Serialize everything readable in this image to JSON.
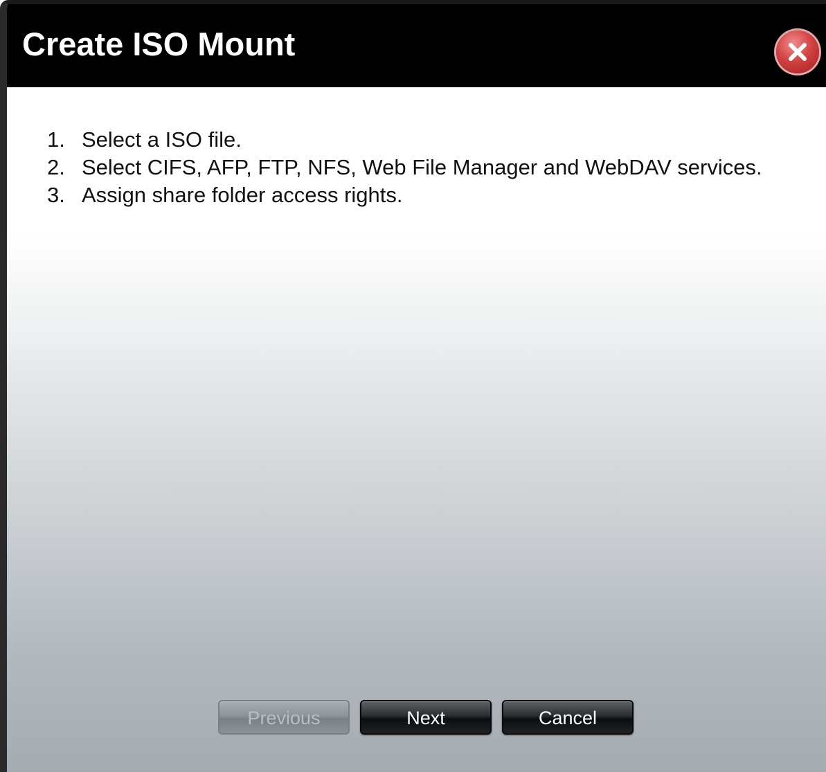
{
  "dialog": {
    "title": "Create ISO Mount",
    "steps": [
      {
        "number": "1.",
        "text": "Select a ISO file."
      },
      {
        "number": "2.",
        "text": "Select CIFS, AFP, FTP, NFS, Web File Manager and WebDAV services."
      },
      {
        "number": "3.",
        "text": "Assign share folder access rights."
      }
    ],
    "buttons": {
      "previous_label": "Previous",
      "next_label": "Next",
      "cancel_label": "Cancel"
    }
  },
  "icons": {
    "close": "close-icon"
  },
  "colors": {
    "title_bar": "#000000",
    "close_button": "#d24343"
  }
}
